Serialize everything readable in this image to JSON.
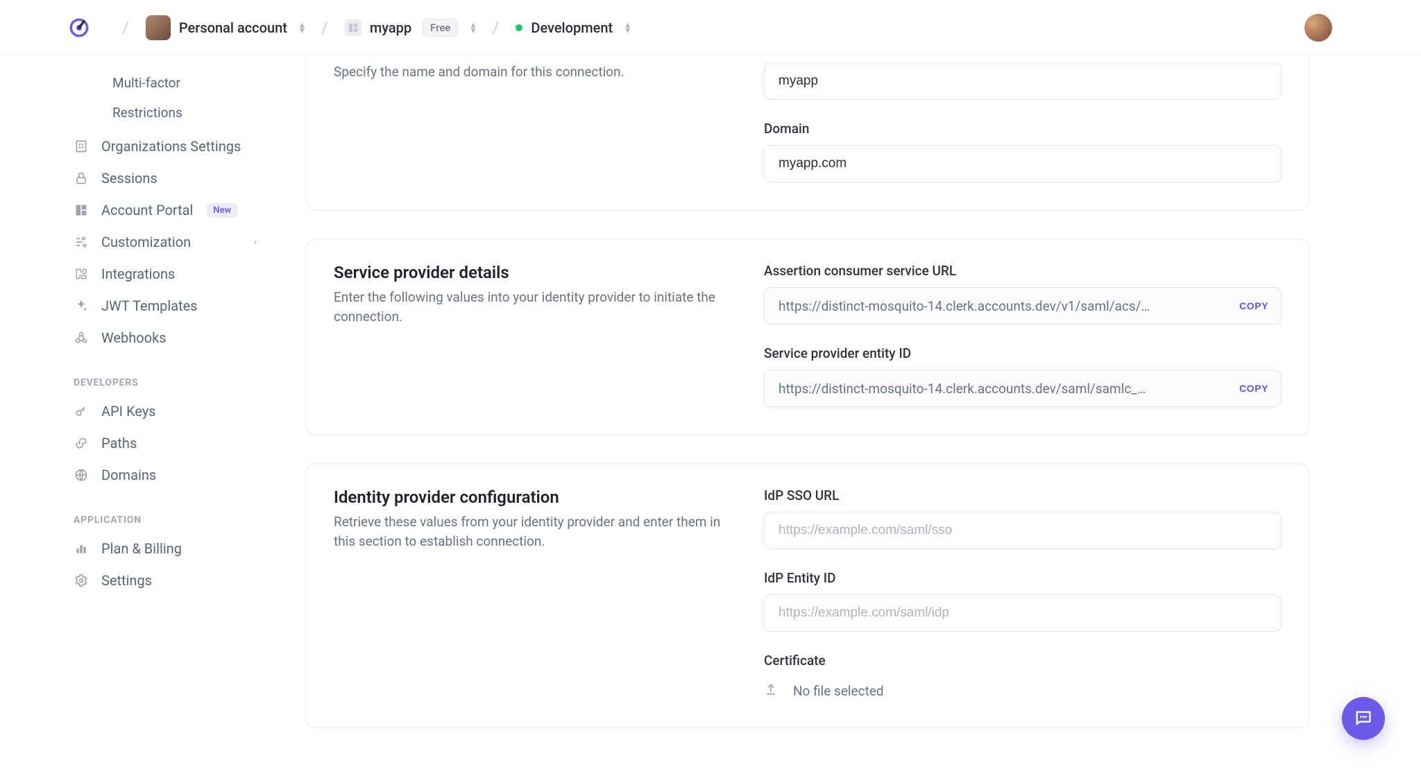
{
  "breadcrumb": {
    "account": "Personal account",
    "app": "myapp",
    "plan": "Free",
    "env": "Development"
  },
  "sidebar": {
    "sublinks": {
      "multi_factor": "Multi-factor",
      "restrictions": "Restrictions"
    },
    "items": {
      "organizations": "Organizations Settings",
      "sessions": "Sessions",
      "account_portal": "Account Portal",
      "account_portal_badge": "New",
      "customization": "Customization",
      "integrations": "Integrations",
      "jwt_templates": "JWT Templates",
      "webhooks": "Webhooks"
    },
    "section_developers": "DEVELOPERS",
    "dev_items": {
      "api_keys": "API Keys",
      "paths": "Paths",
      "domains": "Domains"
    },
    "section_application": "APPLICATION",
    "app_items": {
      "plan_billing": "Plan & Billing",
      "settings": "Settings"
    }
  },
  "sections": {
    "naming": {
      "desc": "Specify the name and domain for this connection.",
      "name_value": "myapp",
      "domain_label": "Domain",
      "domain_value": "myapp.com"
    },
    "sp": {
      "title": "Service provider details",
      "desc": "Enter the following values into your identity provider to initiate the connection.",
      "acs_label": "Assertion consumer service URL",
      "acs_value": "https://distinct-mosquito-14.clerk.accounts.dev/v1/saml/acs/…",
      "entity_label": "Service provider entity ID",
      "entity_value": "https://distinct-mosquito-14.clerk.accounts.dev/saml/samlc_…",
      "copy": "COPY"
    },
    "idp": {
      "title": "Identity provider configuration",
      "desc": "Retrieve these values from your identity provider and enter them in this section to establish connection.",
      "sso_label": "IdP SSO URL",
      "sso_placeholder": "https://example.com/saml/sso",
      "entity_label": "IdP Entity ID",
      "entity_placeholder": "https://example.com/saml/idp",
      "cert_label": "Certificate",
      "cert_empty": "No file selected"
    }
  }
}
